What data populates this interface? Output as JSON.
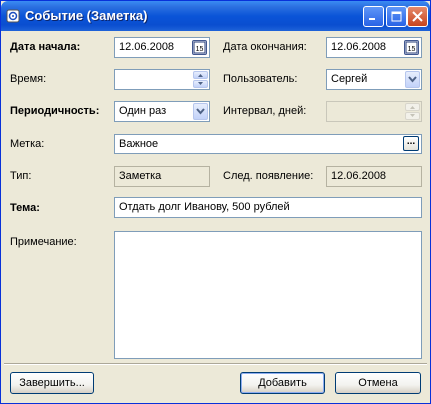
{
  "window": {
    "title": "Событие (Заметка)",
    "icon": "app-icon",
    "controls": [
      "minimize-icon",
      "maximize-icon",
      "close-icon"
    ]
  },
  "form": {
    "start_date": {
      "label": "Дата начала:",
      "value": "12.06.2008",
      "icon": "calendar-icon",
      "calendar_icon_text": "15"
    },
    "end_date": {
      "label": "Дата окончания:",
      "value": "12.06.2008",
      "icon": "calendar-icon",
      "calendar_icon_text": "15"
    },
    "time": {
      "label": "Время:",
      "value": ""
    },
    "user": {
      "label": "Пользователь:",
      "value": "Сергей"
    },
    "periodicity": {
      "label": "Периодичность:",
      "value": "Один раз"
    },
    "interval": {
      "label": "Интервал, дней:",
      "value": ""
    },
    "tag": {
      "label": "Метка:",
      "value": "Важное",
      "button_text": "..."
    },
    "type": {
      "label": "Тип:",
      "value": "Заметка"
    },
    "next": {
      "label": "След. появление:",
      "value": "12.06.2008"
    },
    "subject": {
      "label": "Тема:",
      "value": "Отдать долг Иванову, 500 рублей"
    },
    "note": {
      "label": "Примечание:",
      "value": ""
    }
  },
  "buttons": {
    "finish": "Завершить...",
    "add": "Добавить",
    "cancel": "Отмена"
  },
  "colors": {
    "titlebar": "#0a54d8",
    "dialog_bg": "#ece9d8",
    "field_border": "#7f9db9"
  }
}
